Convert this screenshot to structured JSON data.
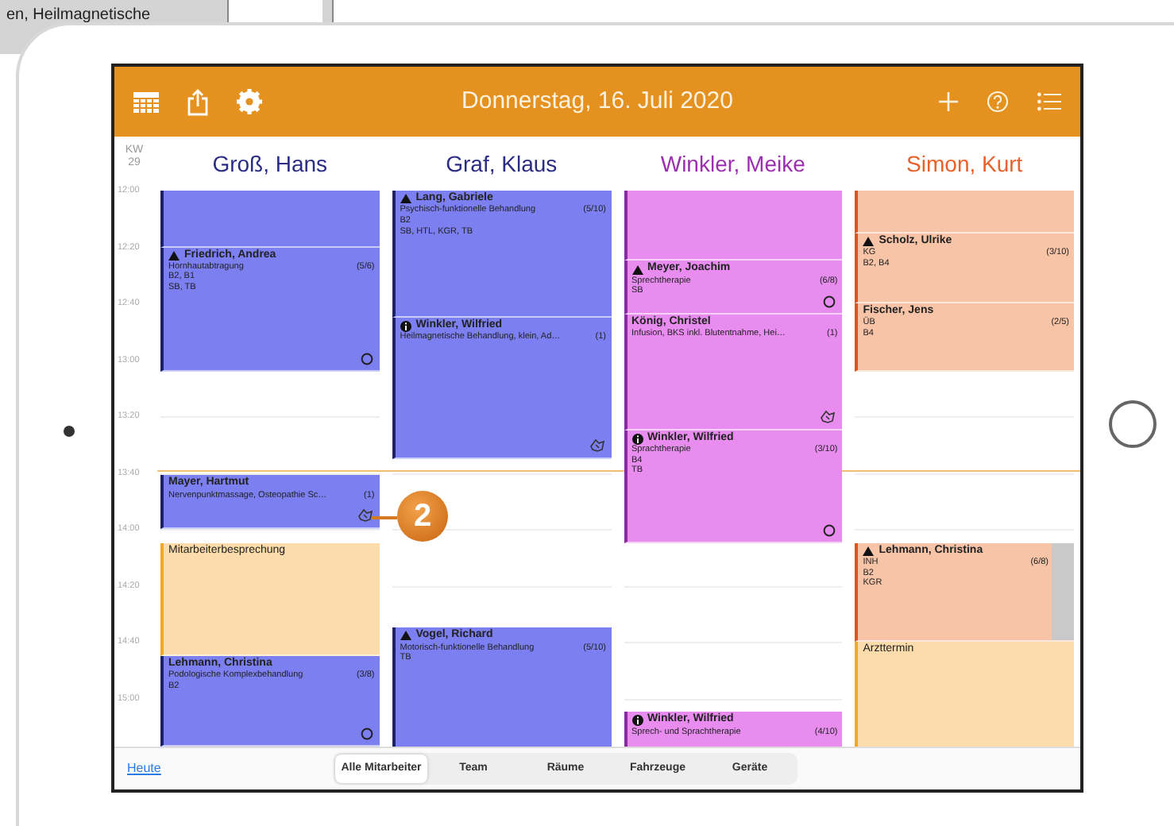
{
  "page_text": "en, Heilmagnetische",
  "toolbar": {
    "title": "Donnerstag, 16. Juli 2020"
  },
  "week": {
    "label": "KW",
    "number": "29"
  },
  "time_labels": [
    "12:00",
    "12:20",
    "12:40",
    "13:00",
    "13:20",
    "13:40",
    "14:00",
    "14:20",
    "14:40",
    "15:00"
  ],
  "columns": [
    {
      "name": "Groß, Hans",
      "color": "#7b7ff0",
      "events": [
        {
          "kind": "appointment"
        },
        {
          "kind": "appointment",
          "warning": true,
          "info": false,
          "sync": true,
          "handshake": false,
          "overlap": false,
          "name": "Friedrich, Andrea",
          "service": "Hornhautabtragung",
          "count": "(5/6)",
          "lines": [
            "B2, B1",
            "SB, TB"
          ]
        },
        {
          "kind": "appointment",
          "warning": false,
          "info": false,
          "sync": false,
          "handshake": true,
          "overlap": false,
          "name": "Mayer, Hartmut",
          "service": "Nervenpunktmassage, Osteopathie Sc…",
          "count": "(1)"
        },
        {
          "kind": "blocker",
          "name": "Mitarbeiterbesprechung"
        },
        {
          "kind": "appointment",
          "warning": false,
          "info": false,
          "sync": true,
          "handshake": false,
          "overlap": false,
          "name": "Lehmann, Christina",
          "service": "Podologische Komplexbehandlung",
          "count": "(3/8)",
          "lines": [
            "B2"
          ]
        }
      ]
    },
    {
      "name": "Graf, Klaus",
      "color": "#7b7ff0",
      "events": [
        {
          "kind": "appointment",
          "warning": true,
          "info": false,
          "sync": false,
          "handshake": false,
          "overlap": false,
          "name": "Lang, Gabriele",
          "service": "Psychisch-funktionelle Behandlung",
          "count": "(5/10)",
          "lines": [
            "B2",
            "SB, HTL, KGR, TB"
          ]
        },
        {
          "kind": "appointment",
          "warning": false,
          "info": true,
          "sync": false,
          "handshake": true,
          "overlap": false,
          "name": "Winkler, Wilfried",
          "service": "Heilmagnetische Behandlung, klein, Ad…",
          "count": "(1)"
        },
        {
          "kind": "appointment",
          "warning": true,
          "info": false,
          "sync": false,
          "handshake": false,
          "overlap": false,
          "name": "Vogel, Richard",
          "service": "Motorisch-funktionelle Behandlung",
          "count": "(5/10)",
          "lines": [
            "TB"
          ]
        }
      ]
    },
    {
      "name": "Winkler, Meike",
      "color": "#e98cf0",
      "events": [
        {
          "kind": "appointment"
        },
        {
          "kind": "appointment",
          "warning": true,
          "info": false,
          "sync": true,
          "handshake": false,
          "overlap": false,
          "name": "Meyer, Joachim",
          "service": "Sprechtherapie",
          "count": "(6/8)",
          "lines": [
            "SB"
          ]
        },
        {
          "kind": "appointment",
          "warning": false,
          "info": false,
          "sync": false,
          "handshake": true,
          "overlap": false,
          "name": "König, Christel",
          "service": "Infusion, BKS inkl. Blutentnahme, Hei…",
          "count": "(1)"
        },
        {
          "kind": "appointment",
          "warning": false,
          "info": true,
          "sync": true,
          "handshake": false,
          "overlap": false,
          "name": "Winkler, Wilfried",
          "service": "Sprachtherapie",
          "count": "(3/10)",
          "lines": [
            "B4",
            "TB"
          ]
        },
        {
          "kind": "appointment",
          "warning": false,
          "info": true,
          "sync": false,
          "handshake": false,
          "overlap": false,
          "name": "Winkler, Wilfried",
          "service": "Sprech- und Sprachtherapie",
          "count": "(4/10)"
        }
      ]
    },
    {
      "name": "Simon, Kurt",
      "color": "#f8c4a8",
      "events": [
        {
          "kind": "appointment"
        },
        {
          "kind": "appointment",
          "warning": true,
          "info": false,
          "sync": false,
          "handshake": false,
          "overlap": false,
          "name": "Scholz, Ulrike",
          "service": "KG",
          "count": "(3/10)",
          "lines": [
            "B2, B4"
          ]
        },
        {
          "kind": "appointment",
          "warning": false,
          "info": false,
          "sync": false,
          "handshake": false,
          "overlap": false,
          "name": "Fischer, Jens",
          "service": "ÜB",
          "count": "(2/5)",
          "lines": [
            "B4"
          ]
        },
        {
          "kind": "appointment",
          "warning": true,
          "info": false,
          "sync": false,
          "handshake": false,
          "overlap": true,
          "name": "Lehmann, Christina",
          "service": "INH",
          "count": "(6/8)",
          "lines": [
            "B2",
            "KGR"
          ]
        },
        {
          "kind": "blocker",
          "name": "Arzttermin"
        }
      ]
    }
  ],
  "bottom_bar": {
    "today": "Heute",
    "segments": [
      {
        "label": "Alle Mitarbeiter",
        "selected": true
      },
      {
        "label": "Team",
        "selected": false
      },
      {
        "label": "Räume",
        "selected": false
      },
      {
        "label": "Fahrzeuge",
        "selected": false
      },
      {
        "label": "Geräte",
        "selected": false
      }
    ]
  },
  "callout": "2"
}
